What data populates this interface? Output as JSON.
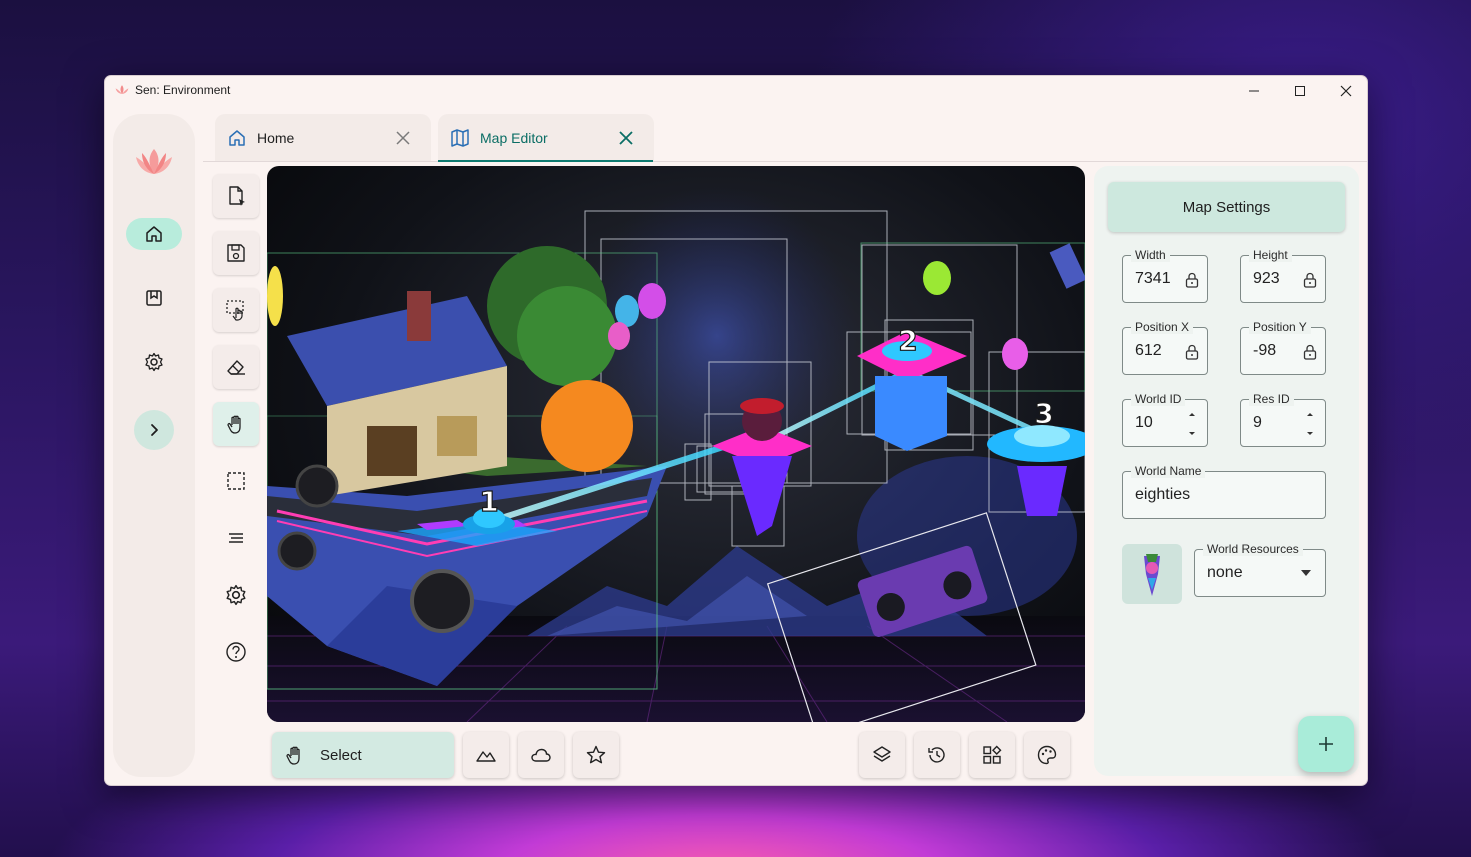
{
  "window": {
    "title": "Sen: Environment"
  },
  "tabs": [
    {
      "label": "Home",
      "icon": "home-icon"
    },
    {
      "label": "Map Editor",
      "icon": "map-icon"
    }
  ],
  "nav_rail": {
    "items": [
      "home-icon",
      "bookmark-icon",
      "gear-icon"
    ],
    "expand_icon": "chevron-right-icon"
  },
  "tools": [
    "open-file-icon",
    "save-icon",
    "select-area-icon",
    "eraser-icon",
    "hand-icon",
    "rectangle-select-icon",
    "align-text-icon",
    "settings-icon",
    "help-icon"
  ],
  "map": {
    "level_labels": [
      "1",
      "2",
      "3"
    ]
  },
  "bottom_bar": {
    "select_label": "Select",
    "mode_icons": [
      "mountain-icon",
      "cloud-icon",
      "star-icon"
    ],
    "view_icons": [
      "layers-icon",
      "history-icon",
      "grid-icon",
      "palette-icon"
    ]
  },
  "map_settings": {
    "title": "Map Settings",
    "width": {
      "label": "Width",
      "value": "7341"
    },
    "height": {
      "label": "Height",
      "value": "923"
    },
    "position_x": {
      "label": "Position X",
      "value": "612"
    },
    "position_y": {
      "label": "Position Y",
      "value": "-98"
    },
    "world_id": {
      "label": "World ID",
      "value": "10"
    },
    "res_id": {
      "label": "Res ID",
      "value": "9"
    },
    "world_name": {
      "label": "World Name",
      "value": "eighties"
    },
    "world_resources": {
      "label": "World Resources",
      "value": "none"
    }
  },
  "colors": {
    "accent": "#0e7a70",
    "tab_active": "#0b6e65",
    "fab": "#a9ecd9",
    "rail_active": "#b8ecdc"
  }
}
